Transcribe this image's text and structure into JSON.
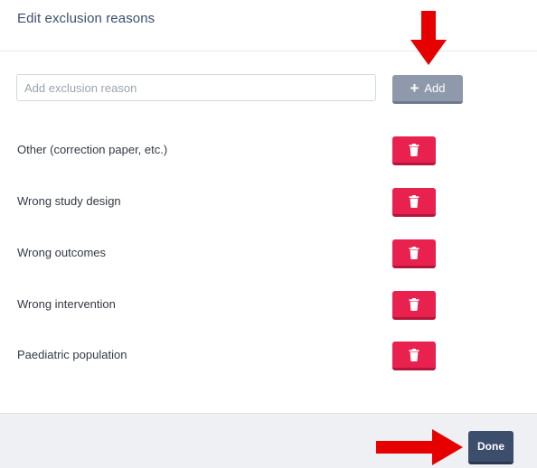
{
  "dialog": {
    "title": "Edit exclusion reasons"
  },
  "add_form": {
    "input_value": "",
    "input_placeholder": "Add exclusion reason",
    "add_label": "Add",
    "add_icon": "plus-icon"
  },
  "reasons": [
    {
      "label": "Other (correction paper, etc.)"
    },
    {
      "label": "Wrong study design"
    },
    {
      "label": "Wrong outcomes"
    },
    {
      "label": "Wrong intervention"
    },
    {
      "label": "Paediatric population"
    }
  ],
  "delete_icon": "trash-icon",
  "footer": {
    "done_label": "Done"
  },
  "annotations": {
    "arrow_color": "#e60000",
    "arrows": [
      "arrow-down-icon",
      "arrow-right-icon"
    ]
  },
  "colors": {
    "title": "#3c4f6d",
    "add_button": "#8e99ab",
    "delete_button": "#e8214f",
    "done_button": "#3d4e6c",
    "footer_bg": "#eef0f3"
  }
}
